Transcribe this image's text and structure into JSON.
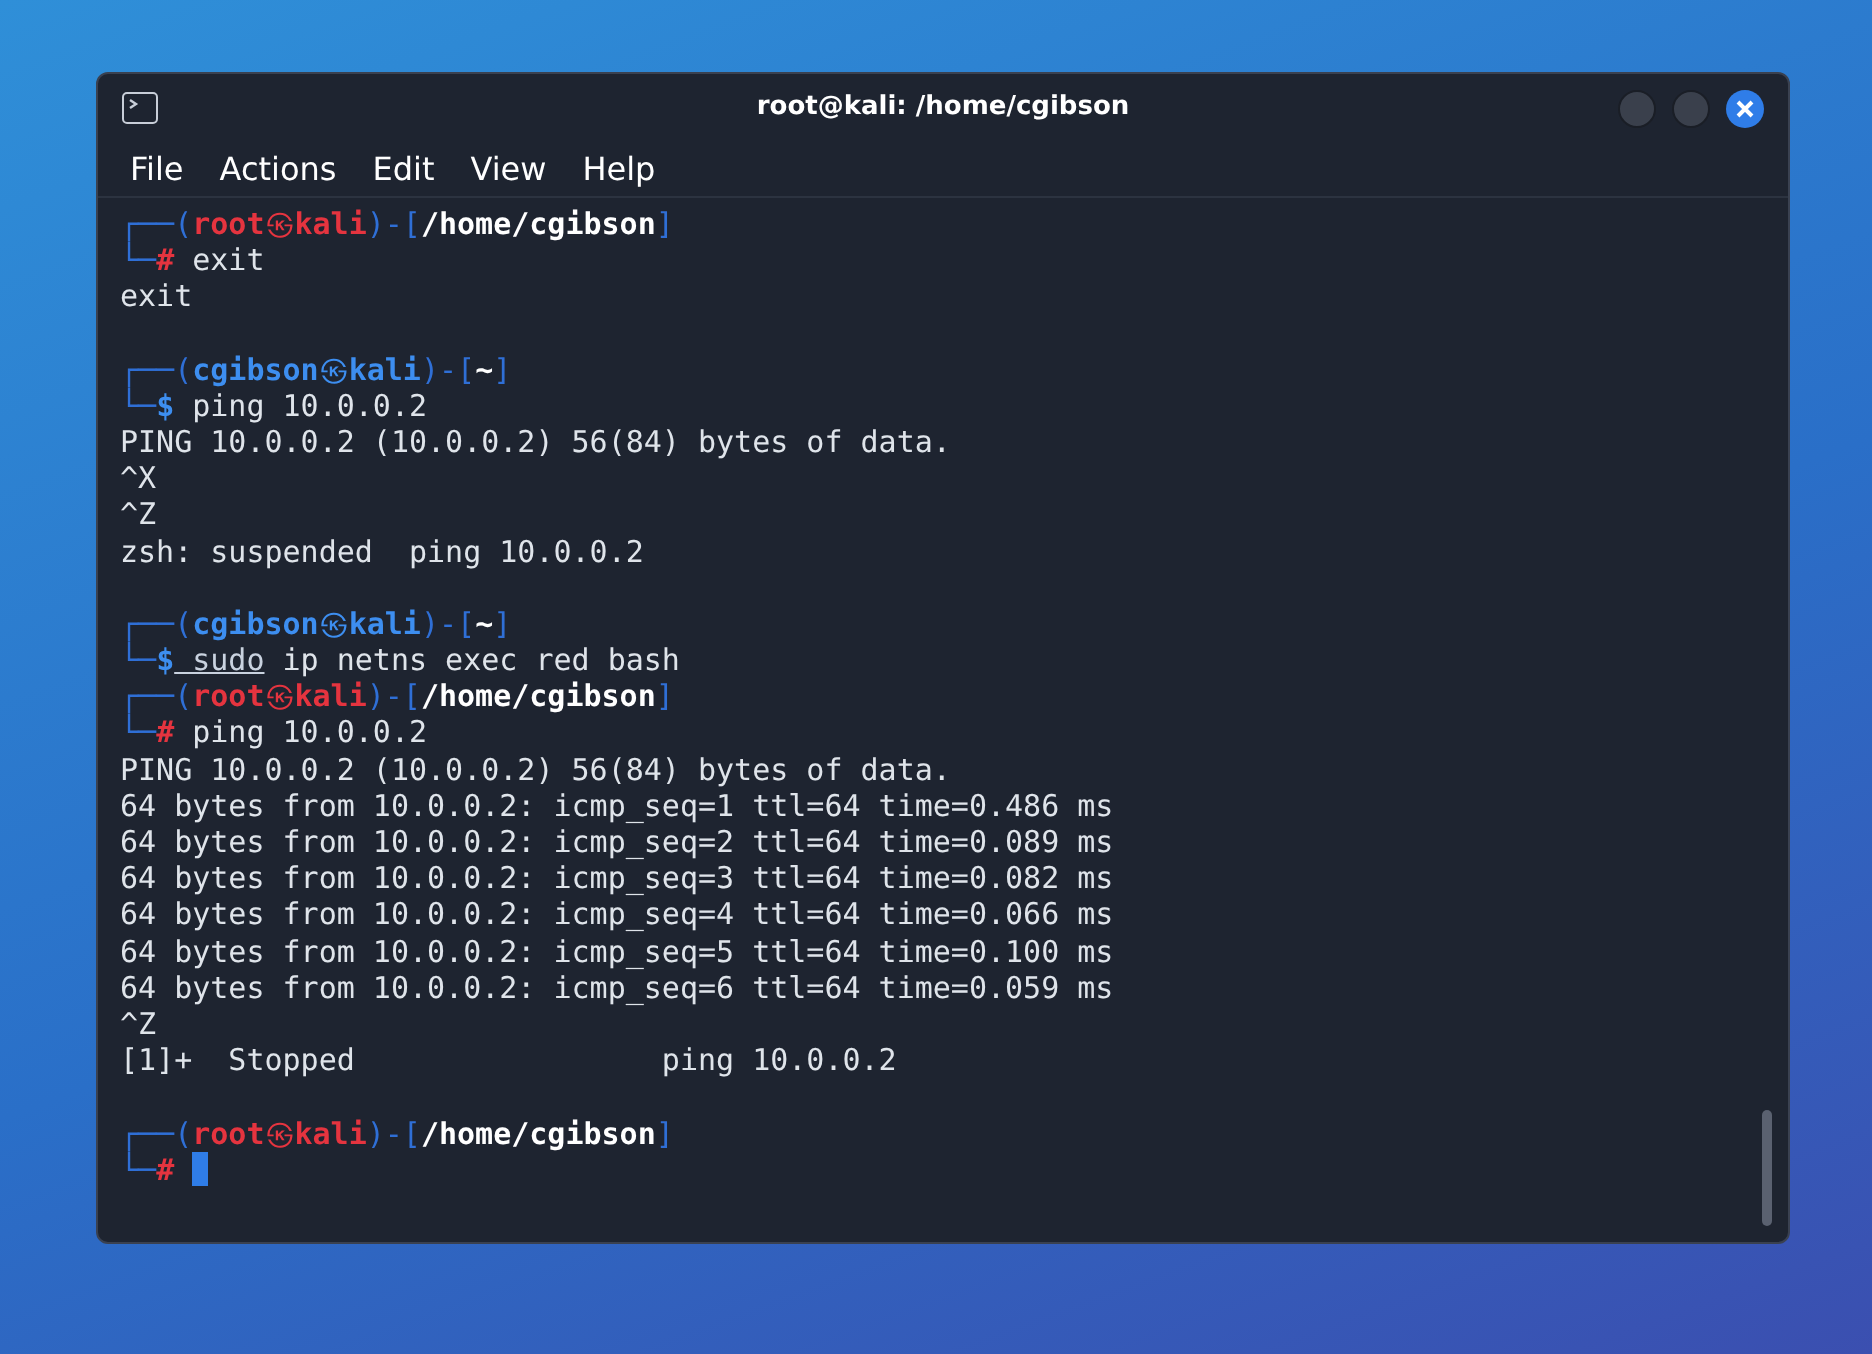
{
  "window": {
    "title": "root@kali: /home/cgibson"
  },
  "menu": [
    "File",
    "Actions",
    "Edit",
    "View",
    "Help"
  ],
  "lines": [
    {
      "kind": "prompt",
      "corner": "┌──(",
      "user": "root",
      "at": "㉿",
      "host": "kali",
      "sep": ")-[",
      "path": "/home/cgibson",
      "end": "]",
      "root": true
    },
    {
      "kind": "command",
      "corner": "└─",
      "symbol": "#",
      "root": true,
      "words": [
        {
          "text": "exit",
          "underline": false
        }
      ],
      "cursor": false
    },
    {
      "kind": "output",
      "text": "exit"
    },
    {
      "kind": "blank"
    },
    {
      "kind": "prompt",
      "corner": "┌──(",
      "user": "cgibson",
      "at": "㉿",
      "host": "kali",
      "sep": ")-[",
      "path": "~",
      "end": "]",
      "root": false
    },
    {
      "kind": "command",
      "corner": "└─",
      "symbol": "$",
      "root": false,
      "words": [
        {
          "text": "ping",
          "underline": false
        },
        {
          "text": "10.0.0.2",
          "underline": false
        }
      ],
      "cursor": false
    },
    {
      "kind": "output",
      "text": "PING 10.0.0.2 (10.0.0.2) 56(84) bytes of data."
    },
    {
      "kind": "output",
      "text": "^X"
    },
    {
      "kind": "output",
      "text": "^Z"
    },
    {
      "kind": "output",
      "text": "zsh: suspended  ping 10.0.0.2"
    },
    {
      "kind": "blank"
    },
    {
      "kind": "prompt",
      "corner": "┌──(",
      "user": "cgibson",
      "at": "㉿",
      "host": "kali",
      "sep": ")-[",
      "path": "~",
      "end": "]",
      "root": false
    },
    {
      "kind": "command",
      "corner": "└─",
      "symbol": "$",
      "root": false,
      "words": [
        {
          "text": "sudo",
          "underline": true
        },
        {
          "text": "ip",
          "underline": false
        },
        {
          "text": "netns",
          "underline": false
        },
        {
          "text": "exec",
          "underline": false
        },
        {
          "text": "red",
          "underline": false
        },
        {
          "text": "bash",
          "underline": false
        }
      ],
      "cursor": false
    },
    {
      "kind": "prompt",
      "corner": "┌──(",
      "user": "root",
      "at": "㉿",
      "host": "kali",
      "sep": ")-[",
      "path": "/home/cgibson",
      "end": "]",
      "root": true
    },
    {
      "kind": "command",
      "corner": "└─",
      "symbol": "#",
      "root": true,
      "words": [
        {
          "text": "ping",
          "underline": false
        },
        {
          "text": "10.0.0.2",
          "underline": false
        }
      ],
      "cursor": false
    },
    {
      "kind": "output",
      "text": "PING 10.0.0.2 (10.0.0.2) 56(84) bytes of data."
    },
    {
      "kind": "output",
      "text": "64 bytes from 10.0.0.2: icmp_seq=1 ttl=64 time=0.486 ms"
    },
    {
      "kind": "output",
      "text": "64 bytes from 10.0.0.2: icmp_seq=2 ttl=64 time=0.089 ms"
    },
    {
      "kind": "output",
      "text": "64 bytes from 10.0.0.2: icmp_seq=3 ttl=64 time=0.082 ms"
    },
    {
      "kind": "output",
      "text": "64 bytes from 10.0.0.2: icmp_seq=4 ttl=64 time=0.066 ms"
    },
    {
      "kind": "output",
      "text": "64 bytes from 10.0.0.2: icmp_seq=5 ttl=64 time=0.100 ms"
    },
    {
      "kind": "output",
      "text": "64 bytes from 10.0.0.2: icmp_seq=6 ttl=64 time=0.059 ms"
    },
    {
      "kind": "output",
      "text": "^Z"
    },
    {
      "kind": "output",
      "text": "[1]+  Stopped                 ping 10.0.0.2"
    },
    {
      "kind": "blank"
    },
    {
      "kind": "prompt",
      "corner": "┌──(",
      "user": "root",
      "at": "㉿",
      "host": "kali",
      "sep": ")-[",
      "path": "/home/cgibson",
      "end": "]",
      "root": true
    },
    {
      "kind": "command",
      "corner": "└─",
      "symbol": "#",
      "root": true,
      "cursor": true
    }
  ]
}
